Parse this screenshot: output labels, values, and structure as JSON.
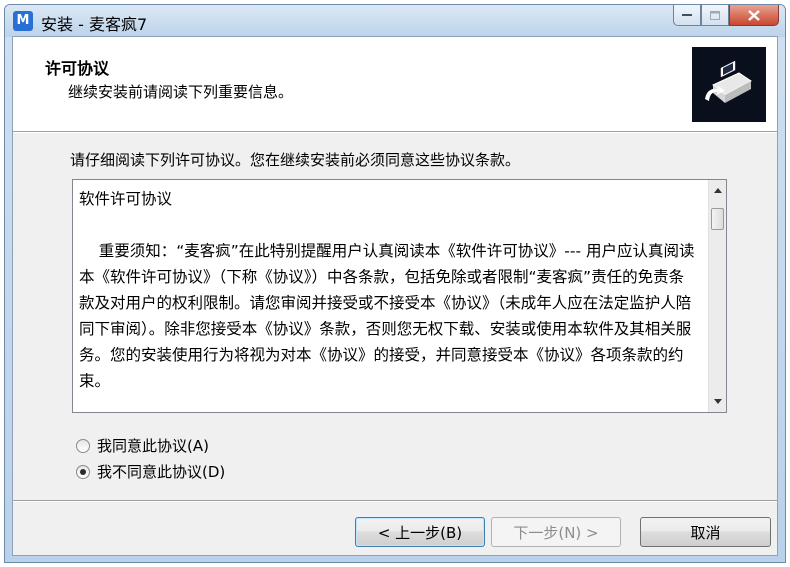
{
  "window": {
    "title": "安装 - 麦客疯7",
    "icon": "app-logo-icon"
  },
  "header": {
    "title": "许可协议",
    "subtitle": "继续安装前请阅读下列重要信息。"
  },
  "prompt": "请仔细阅读下列许可协议。您在继续安装前必须同意这些协议条款。",
  "license": {
    "text": "软件许可协议\n\n    重要须知：“麦客疯”在此特别提醒用户认真阅读本《软件许可协议》--- 用户应认真阅读本《软件许可协议》（下称《协议》）中各条款，包括免除或者限制“麦客疯”责任的免责条款及对用户的权利限制。请您审阅并接受或不接受本《协议》（未成年人应在法定监护人陪同下审阅）。除非您接受本《协议》条款，否则您无权下载、安装或使用本软件及其相关服务。您的安装使用行为将视为对本《协议》的接受，并同意接受本《协议》各项条款的约束。"
  },
  "options": {
    "accept_label": "我同意此协议(A)",
    "decline_label": "我不同意此协议(D)",
    "selected": "decline"
  },
  "buttons": {
    "back": "< 上一步(B)",
    "next": "下一步(N) >",
    "cancel": "取消"
  },
  "colors": {
    "dialog_bg": "#f0f0f0",
    "header_bg": "#ffffff",
    "logo_bg": "#0a0f1e",
    "close_button": "#c9472f"
  }
}
